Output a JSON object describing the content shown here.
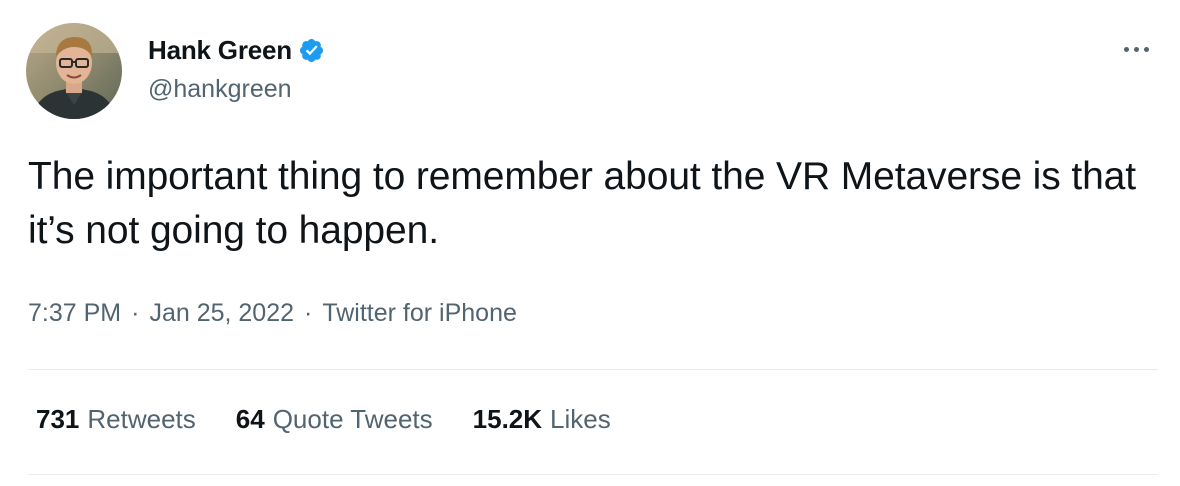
{
  "author": {
    "display_name": "Hank Green",
    "handle": "@hankgreen",
    "verified": true
  },
  "tweet": {
    "text": "The important thing to remember about the VR Metaverse is that it’s not going to happen."
  },
  "meta": {
    "time": "7:37 PM",
    "separator": "·",
    "date": "Jan 25, 2022",
    "source": "Twitter for iPhone"
  },
  "stats": [
    {
      "count": "731",
      "label": "Retweets"
    },
    {
      "count": "64",
      "label": "Quote Tweets"
    },
    {
      "count": "15.2K",
      "label": "Likes"
    }
  ],
  "icons": {
    "verified": "verified-badge-icon",
    "more": "more-options-icon"
  },
  "colors": {
    "text_primary": "#0f1419",
    "text_secondary": "#536471",
    "verified_blue": "#1d9bf0",
    "divider": "#e6ecf0"
  }
}
